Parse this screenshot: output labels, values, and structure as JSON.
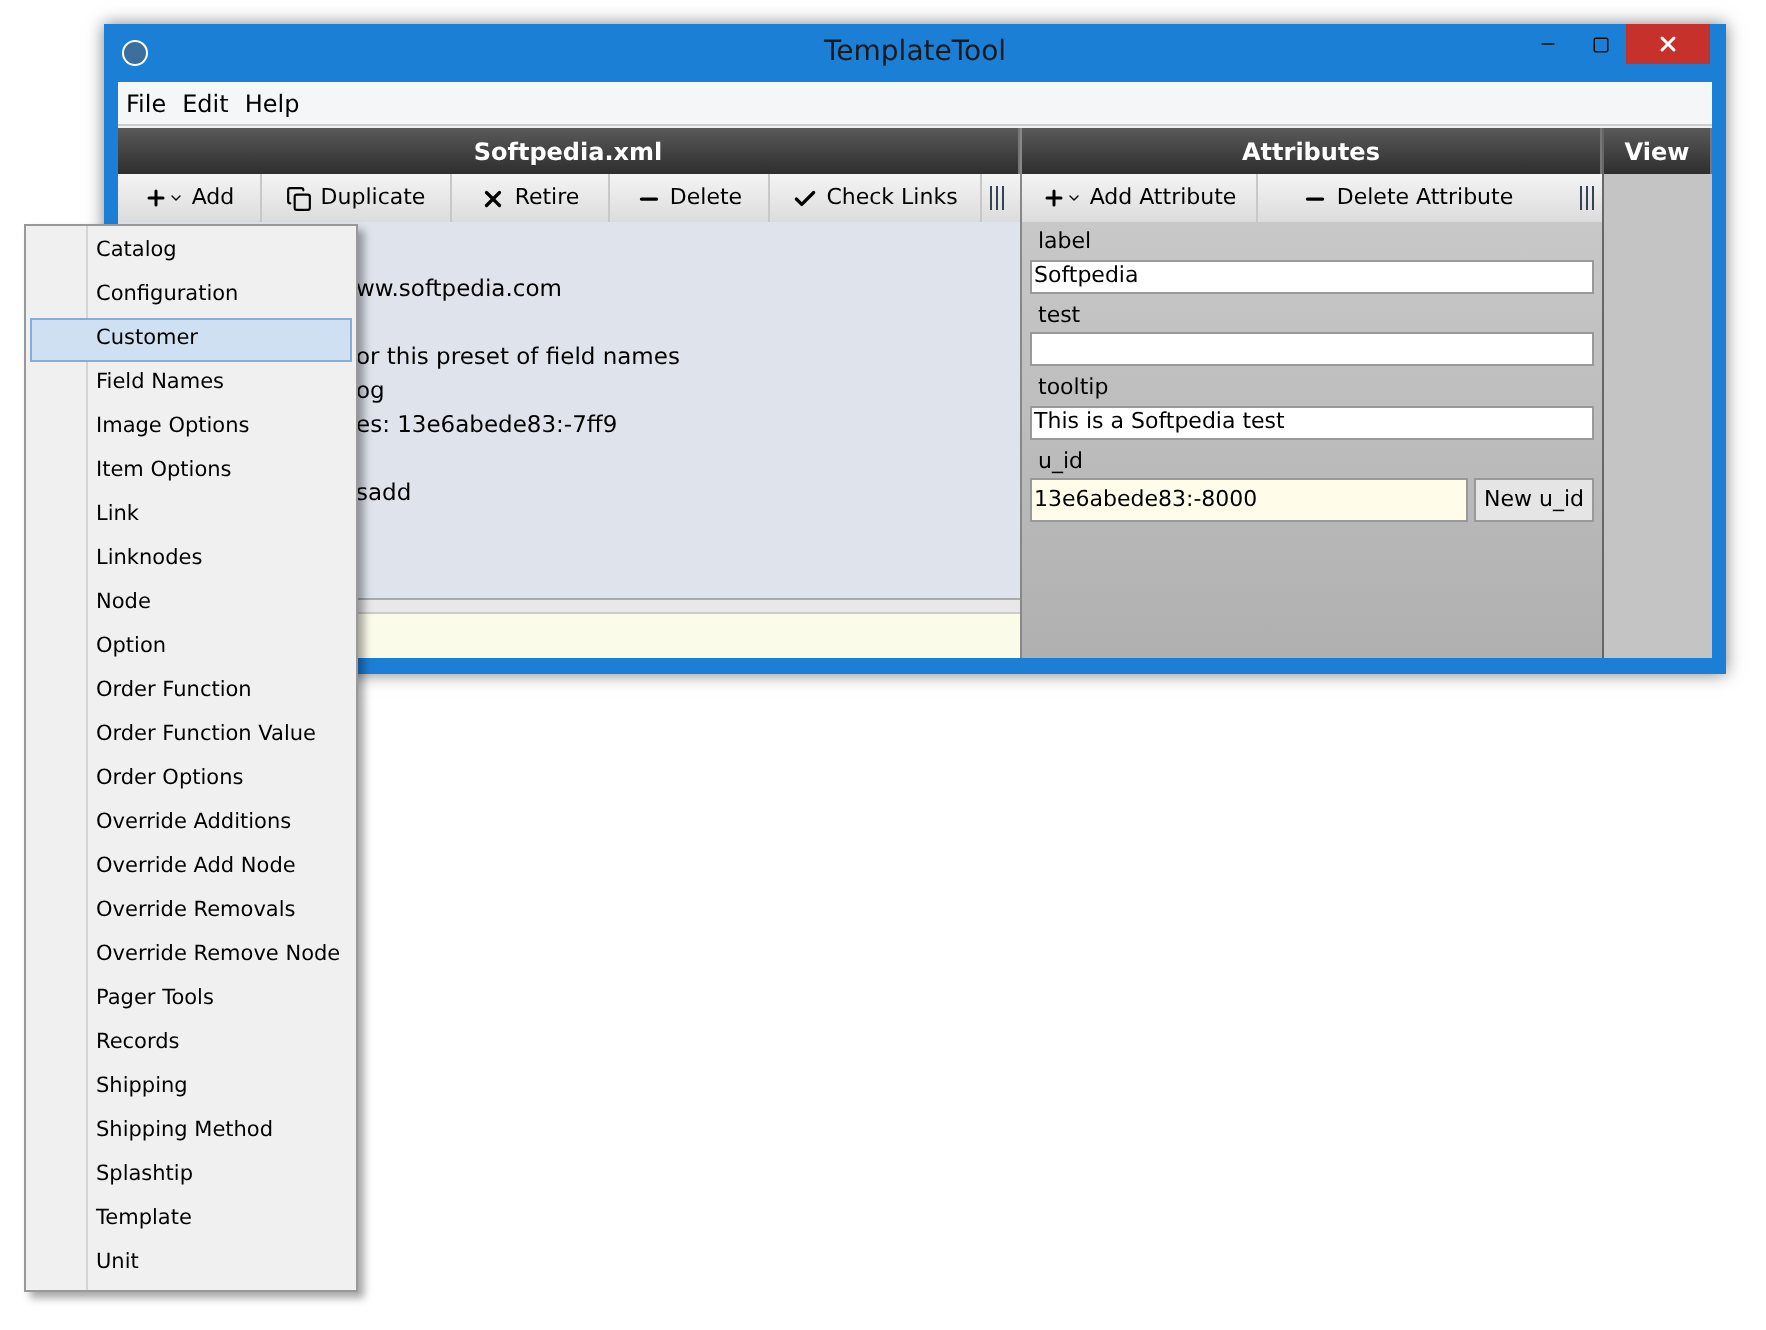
{
  "window": {
    "title": "TemplateTool"
  },
  "menu_bar": [
    "File",
    "Edit",
    "Help"
  ],
  "left_panel": {
    "title": "Softpedia.xml",
    "toolbar": [
      {
        "kind": "add",
        "label": "Add"
      },
      {
        "kind": "duplicate",
        "label": "Duplicate"
      },
      {
        "kind": "retire",
        "label": "Retire"
      },
      {
        "kind": "delete",
        "label": "Delete"
      },
      {
        "kind": "check",
        "label": "Check Links"
      }
    ],
    "paragraphs": [
      [
        "ww.softpedia.com"
      ],
      [
        "or this preset of field names",
        "og",
        "es: 13e6abede83:-7ff9"
      ],
      [
        "sadd"
      ]
    ]
  },
  "attributes_panel": {
    "title": "Attributes",
    "toolbar": [
      {
        "kind": "add",
        "label": "Add Attribute"
      },
      {
        "kind": "delete",
        "label": "Delete Attribute"
      }
    ],
    "fields": [
      {
        "label": "label",
        "value": "Softpedia"
      },
      {
        "label": "test"
      },
      {
        "label": "tooltip",
        "value": "This is a Softpedia test"
      },
      {
        "label": "u_id",
        "value": "13e6abede83:-8000",
        "button": "New u_id"
      }
    ]
  },
  "view_panel": {
    "title": "View"
  },
  "dropdown": [
    {
      "label": "Catalog",
      "selected": false
    },
    {
      "label": "Configuration",
      "selected": false
    },
    {
      "label": "Customer",
      "selected": true
    },
    {
      "label": "Field Names",
      "selected": false
    },
    {
      "label": "Image Options",
      "selected": false
    },
    {
      "label": "Item Options",
      "selected": false
    },
    {
      "label": "Link",
      "selected": false
    },
    {
      "label": "Linknodes",
      "selected": false
    },
    {
      "label": "Node",
      "selected": false
    },
    {
      "label": "Option",
      "selected": false
    },
    {
      "label": "Order Function",
      "selected": false
    },
    {
      "label": "Order Function Value",
      "selected": false
    },
    {
      "label": "Order Options",
      "selected": false
    },
    {
      "label": "Override Additions",
      "selected": false
    },
    {
      "label": "Override Add Node",
      "selected": false
    },
    {
      "label": "Override Removals",
      "selected": false
    },
    {
      "label": "Override Remove Node",
      "selected": false
    },
    {
      "label": "Pager Tools",
      "selected": false
    },
    {
      "label": "Records",
      "selected": false
    },
    {
      "label": "Shipping",
      "selected": false
    },
    {
      "label": "Shipping Method",
      "selected": false
    },
    {
      "label": "Splashtip",
      "selected": false
    },
    {
      "label": "Template",
      "selected": false
    },
    {
      "label": "Unit",
      "selected": false
    }
  ]
}
